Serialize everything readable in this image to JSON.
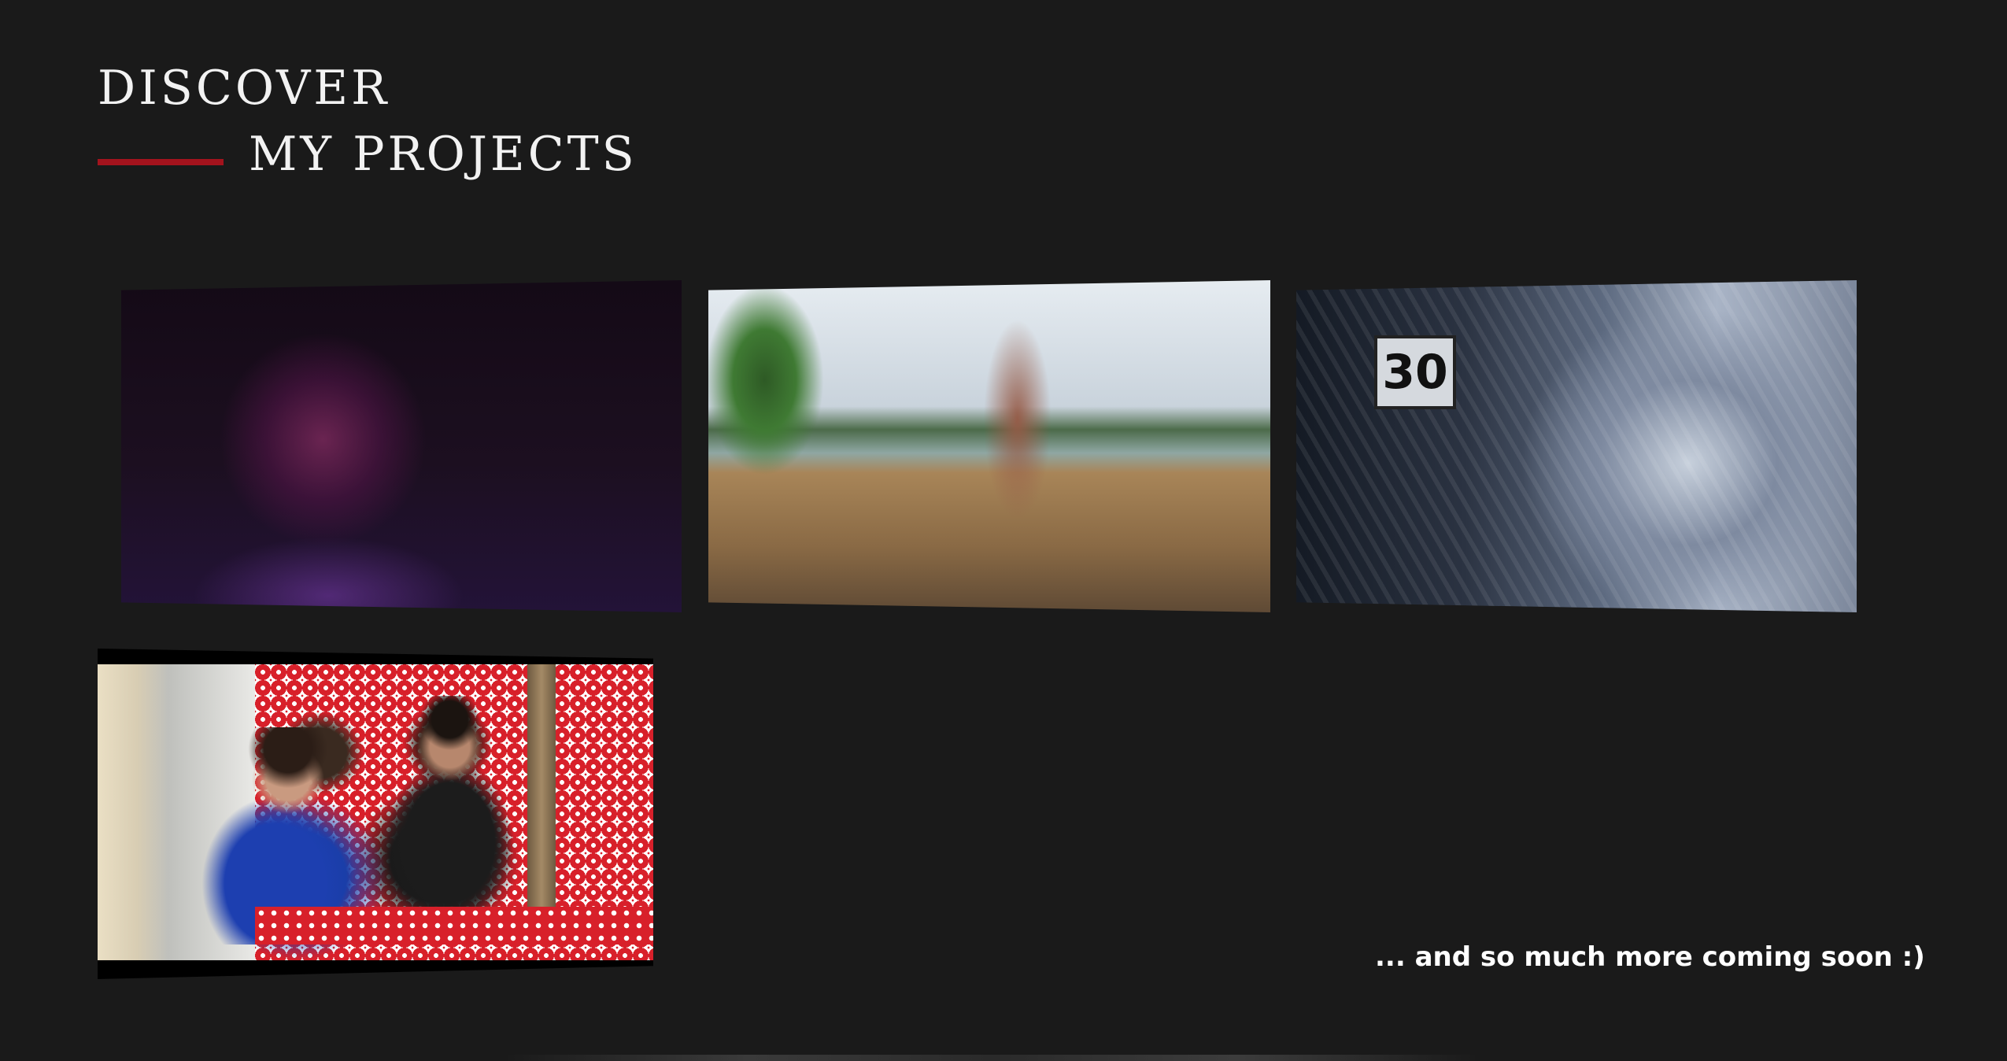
{
  "header": {
    "line1": "DISCOVER",
    "line2": "MY PROJECTS"
  },
  "projects": [
    {
      "label": "project-thumbnail-portrait"
    },
    {
      "label": "project-thumbnail-beach-dock"
    },
    {
      "label": "project-thumbnail-road-sign"
    },
    {
      "label": "project-thumbnail-cafe-couple"
    }
  ],
  "thumbnail_3": {
    "sign_text": "30"
  },
  "footer": {
    "coming_soon": "... and so much more coming soon :)"
  },
  "colors": {
    "background": "#1a1a1a",
    "accent": "#a3131d",
    "text": "#ffffff"
  }
}
